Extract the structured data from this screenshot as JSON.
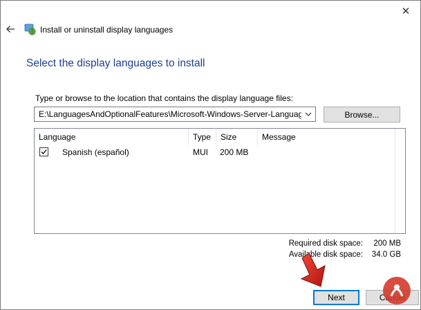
{
  "window": {
    "title": "Install or uninstall display languages",
    "close_glyph": "✕"
  },
  "page": {
    "heading": "Select the display languages to install",
    "path_label": "Type or browse to the location that contains the display language files:",
    "path_value": "E:\\LanguagesAndOptionalFeatures\\Microsoft-Windows-Server-Languag",
    "browse_label": "Browse..."
  },
  "list": {
    "columns": [
      "Language",
      "Type",
      "Size",
      "Message"
    ],
    "rows": [
      {
        "checked": true,
        "language": "Spanish (español)",
        "type": "MUI",
        "size": "200 MB",
        "message": ""
      }
    ]
  },
  "disk": {
    "required_label": "Required disk space:",
    "required_value": "200 MB",
    "available_label": "Available disk space:",
    "available_value": "34.0 GB"
  },
  "buttons": {
    "next_label": "Next",
    "cancel_label": "Cancel"
  },
  "colors": {
    "heading": "#1c3f94",
    "focus_border": "#0078d7",
    "annotation_arrow": "#e0201b",
    "watermark_logo": "#d33a2c"
  },
  "icons": {
    "back": "back-arrow-icon",
    "app": "language-globe-icon",
    "close": "close-icon",
    "dropdown": "chevron-down-icon",
    "checkbox": "checkmark-icon"
  }
}
